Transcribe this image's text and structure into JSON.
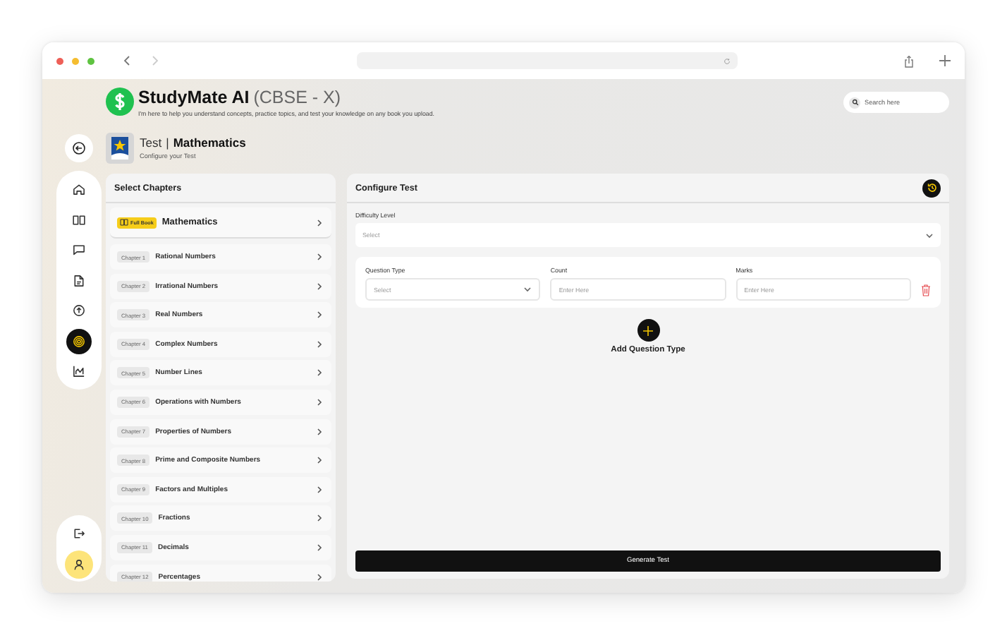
{
  "app": {
    "title": "StudyMate AI",
    "badge": "(CBSE - X)",
    "tagline": "I'm here to help you understand concepts, practice topics, and test your knowledge on any book you upload.",
    "search": {
      "placeholder": "Search here"
    }
  },
  "page": {
    "section": "Test",
    "separator": "|",
    "subject": "Mathematics",
    "subtitle": "Configure your Test"
  },
  "nav": {
    "items": [
      {
        "kind": "home",
        "selected": false
      },
      {
        "kind": "book",
        "selected": false
      },
      {
        "kind": "chat",
        "selected": false
      },
      {
        "kind": "document",
        "selected": false
      },
      {
        "kind": "upload",
        "selected": false
      },
      {
        "kind": "target",
        "selected": true
      },
      {
        "kind": "chart",
        "selected": false
      }
    ],
    "bottom": [
      {
        "kind": "logout"
      },
      {
        "kind": "avatar"
      }
    ]
  },
  "chapters": {
    "title": "Select Chapters",
    "full_book": {
      "tag": "Full Book",
      "name": "Mathematics"
    },
    "items": [
      {
        "label": "Chapter 1",
        "name": "Rational Numbers"
      },
      {
        "label": "Chapter 2",
        "name": "Irrational Numbers"
      },
      {
        "label": "Chapter 3",
        "name": "Real Numbers"
      },
      {
        "label": "Chapter 4",
        "name": "Complex Numbers"
      },
      {
        "label": "Chapter 5",
        "name": "Number Lines"
      },
      {
        "label": "Chapter 6",
        "name": "Operations with Numbers"
      },
      {
        "label": "Chapter 7",
        "name": "Properties of Numbers"
      },
      {
        "label": "Chapter 8",
        "name": "Prime and Composite Numbers"
      },
      {
        "label": "Chapter 9",
        "name": "Factors and Multiples"
      },
      {
        "label": "Chapter 10",
        "name": "Fractions"
      },
      {
        "label": "Chapter 11",
        "name": "Decimals"
      },
      {
        "label": "Chapter 12",
        "name": "Percentages"
      }
    ]
  },
  "configure": {
    "title": "Configure Test",
    "difficulty": {
      "label": "Difficulty Level",
      "placeholder": "Select"
    },
    "question_types": [
      {
        "type": {
          "label": "Question Type",
          "placeholder": "Select"
        },
        "count": {
          "label": "Count",
          "placeholder": "Enter Here"
        },
        "marks": {
          "label": "Marks",
          "placeholder": "Enter Here"
        }
      }
    ],
    "add_label": "Add Question Type",
    "generate": "Generate Test"
  }
}
